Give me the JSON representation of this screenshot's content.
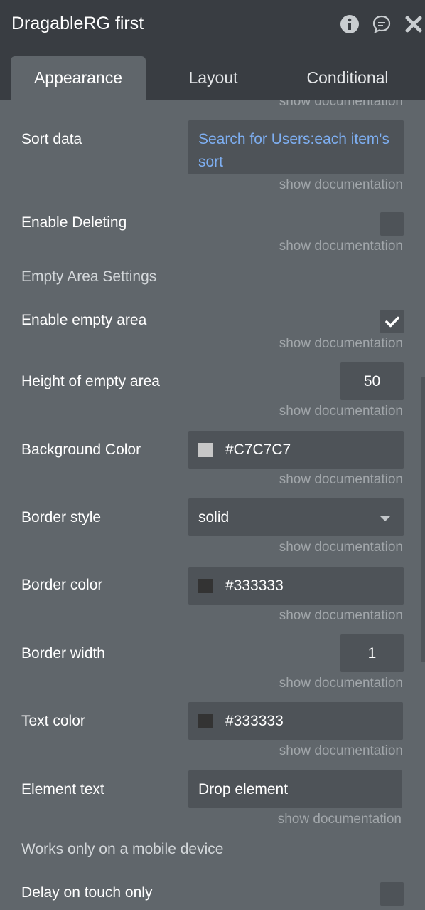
{
  "header": {
    "title": "DragableRG first",
    "icons": [
      "info-icon",
      "comment-icon",
      "close-icon"
    ]
  },
  "tabs": [
    {
      "label": "Appearance",
      "active": true
    },
    {
      "label": "Layout",
      "active": false
    },
    {
      "label": "Conditional",
      "active": false
    }
  ],
  "doc_link": "show documentation",
  "properties": {
    "sort_data": {
      "label": "Sort data",
      "value": "Search for Users:each item's sort"
    },
    "enable_deleting": {
      "label": "Enable Deleting",
      "checked": false
    },
    "empty_area_section": "Empty Area Settings",
    "enable_empty_area": {
      "label": "Enable empty area",
      "checked": true
    },
    "height_empty_area": {
      "label": "Height of empty area",
      "value": "50"
    },
    "background_color": {
      "label": "Background Color",
      "value": "#C7C7C7",
      "swatch": "#C7C7C7"
    },
    "border_style": {
      "label": "Border style",
      "value": "solid"
    },
    "border_color": {
      "label": "Border color",
      "value": "#333333",
      "swatch": "#333333"
    },
    "border_width": {
      "label": "Border width",
      "value": "1"
    },
    "text_color": {
      "label": "Text color",
      "value": "#333333",
      "swatch": "#333333"
    },
    "element_text": {
      "label": "Element text",
      "value": "Drop element"
    },
    "mobile_section": "Works only on a mobile device",
    "delay_touch": {
      "label": "Delay on touch only",
      "checked": false
    }
  },
  "colors": {
    "header_bg": "#393d42",
    "panel_bg": "#60666b",
    "field_bg": "#4e5358",
    "dynamic_text": "#7eaff2"
  }
}
